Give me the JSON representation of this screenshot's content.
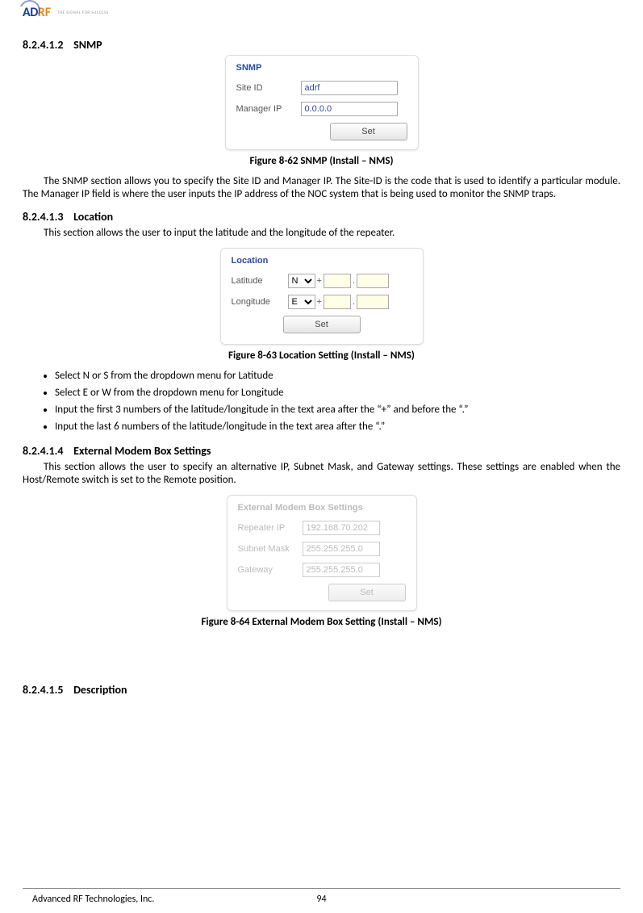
{
  "logo": {
    "ad": "AD",
    "rf": "RF",
    "tag": "THE SIGNAL FOR SUCCESS"
  },
  "sections": {
    "snmp": {
      "num": "8.2.4.1.2",
      "title": "SNMP",
      "panel_title": "SNMP",
      "site_id_label": "Site ID",
      "site_id_value": "adrf",
      "manager_ip_label": "Manager IP",
      "manager_ip_value": "0.0.0.0",
      "set_label": "Set",
      "figcaption": "Figure 8-62    SNMP (Install – NMS)",
      "body": "The SNMP section allows you to specify the Site ID and Manager IP.  The Site-ID is the code that is used to identify a particular module.  The Manager IP field is where the user inputs the IP address of the NOC system that is being used to monitor the SNMP traps."
    },
    "location": {
      "num": "8.2.4.1.3",
      "title": "Location",
      "intro": "This section allows the user to input the latitude and the longitude of the repeater.",
      "panel_title": "Location",
      "lat_label": "Latitude",
      "lat_dir_value": "N",
      "lon_label": "Longitude",
      "lon_dir_value": "E",
      "plus": "+",
      "dot": ".",
      "set_label": "Set",
      "figcaption": "Figure 8-63    Location Setting (Install – NMS)",
      "bullets": [
        "Select N or S from the dropdown menu for Latitude",
        "Select E or W from the dropdown menu for Longitude",
        "Input the first 3 numbers of the latitude/longitude in the text area after the “+” and before the “.”",
        "Input the last 6 numbers of the latitude/longitude in the text area after the “.”"
      ]
    },
    "modem": {
      "num": "8.2.4.1.4",
      "title": "External Modem Box Settings",
      "intro": "This section allows the user to specify an alternative IP, Subnet Mask, and Gateway settings.  These settings are enabled when the Host/Remote switch is set to the Remote position.",
      "panel_title": "External Modem Box Settings",
      "ip_label": "Repeater IP",
      "ip_value": "192.168.70.202",
      "mask_label": "Subnet Mask",
      "mask_value": "255.255.255.0",
      "gw_label": "Gateway",
      "gw_value": "255.255.255.0",
      "set_label": "Set",
      "figcaption": "Figure 8-64    External Modem Box Setting (Install – NMS)"
    },
    "desc": {
      "num": "8.2.4.1.5",
      "title": "Description"
    }
  },
  "footer": {
    "company": "Advanced RF Technologies, Inc.",
    "page": "94"
  }
}
